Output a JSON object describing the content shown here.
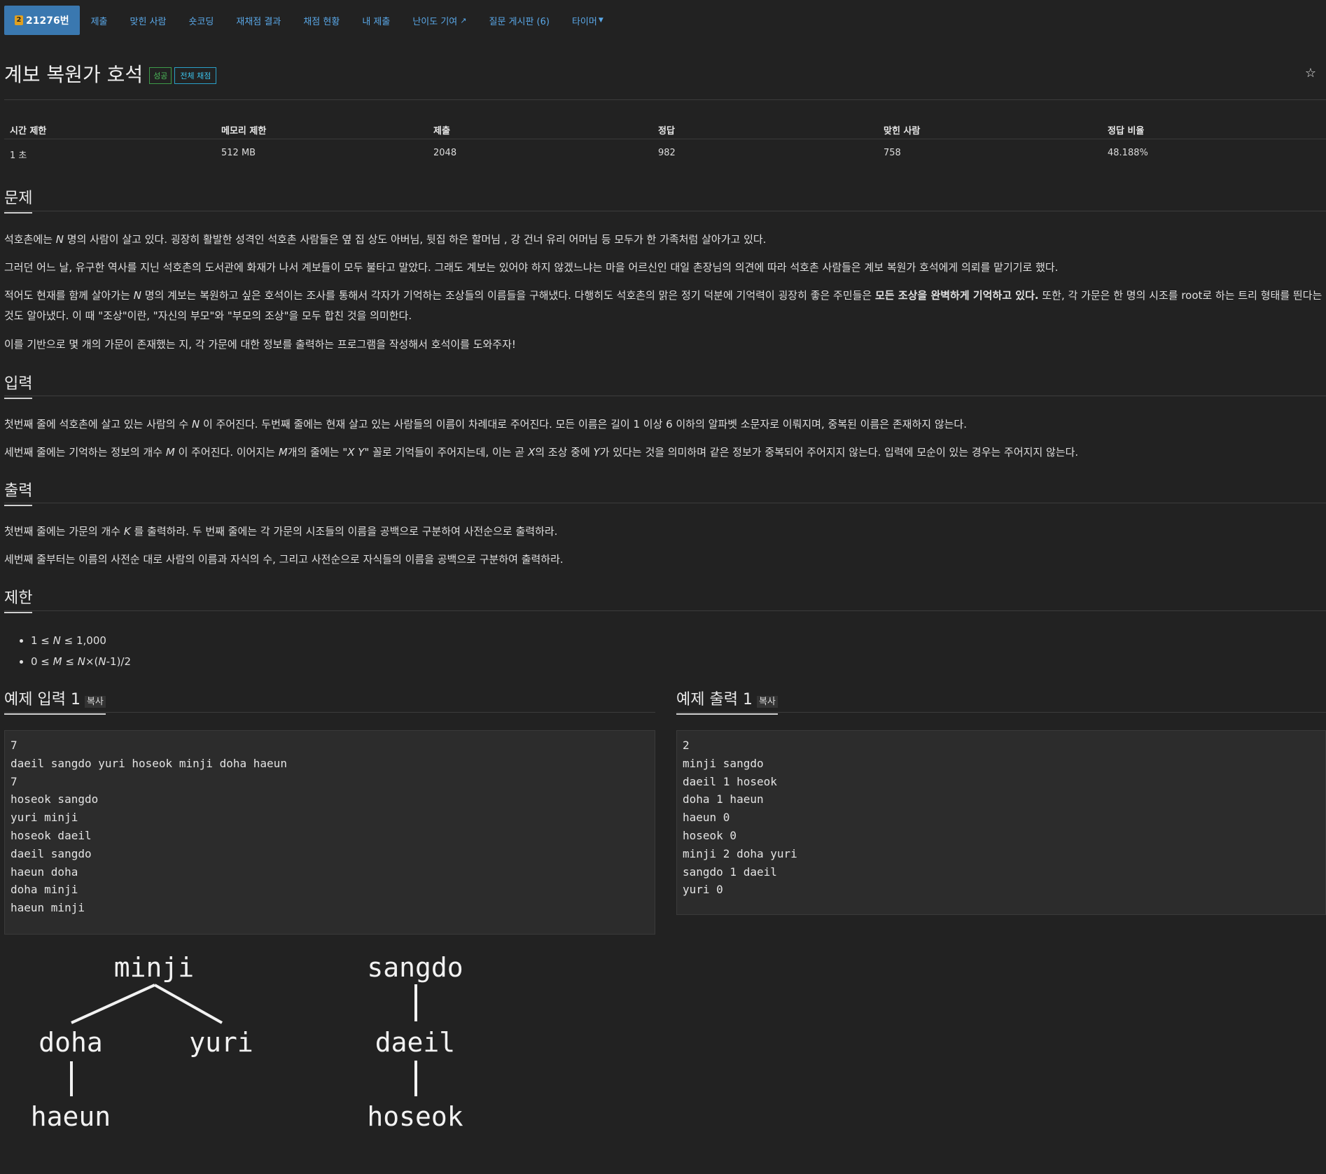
{
  "nav": {
    "problem_no": "21276번",
    "tier_glyph": "2",
    "items": [
      "제출",
      "맞힌 사람",
      "숏코딩",
      "재채점 결과",
      "채점 현황",
      "내 제출",
      "난이도 기여",
      "질문 게시판 (6)",
      "타이머"
    ]
  },
  "title": {
    "text": "계보 복원가 호석",
    "badge_success": "성공",
    "badge_all": "전체 채점",
    "star": "☆"
  },
  "stats": {
    "headers": [
      "시간 제한",
      "메모리 제한",
      "제출",
      "정답",
      "맞힌 사람",
      "정답 비율"
    ],
    "values": [
      "1 초",
      "512 MB",
      "2048",
      "982",
      "758",
      "48.188%"
    ]
  },
  "sections": {
    "problem": "문제",
    "input": "입력",
    "output": "출력",
    "limits": "제한",
    "sample_in": "예제 입력 1",
    "sample_out": "예제 출력 1",
    "copy": "복사"
  },
  "problem": {
    "p1_a": "석호촌에는 ",
    "p1_N": "N",
    "p1_b": " 명의 사람이 살고 있다. 굉장히 활발한 성격인 석호촌 사람들은 옆 집 상도 아버님, 뒷집 하은 할머님 , 강 건너 유리 어머님 등 모두가 한 가족처럼 살아가고 있다.",
    "p2": "그러던 어느 날, 유구한 역사를 지닌 석호촌의 도서관에 화재가 나서 계보들이 모두 불타고 말았다. 그래도 계보는 있어야 하지 않겠느냐는 마을 어르신인 대일 촌장님의 의견에 따라 석호촌 사람들은 계보 복원가 호석에게 의뢰를 맡기기로 했다.",
    "p3_a": "적어도 현재를 함께 살아가는 ",
    "p3_N": "N",
    "p3_b": " 명의 계보는 복원하고 싶은 호석이는 조사를 통해서 각자가 기억하는 조상들의 이름들을 구해냈다. 다행히도 석호촌의 맑은 정기 덕분에 기억력이 굉장히 좋은 주민들은 ",
    "p3_bold": "모든 조상을 완벽하게 기억하고 있다.",
    "p3_c": " 또한, 각 가문은 한 명의 시조를 root로 하는 트리 형태를 띈다는 것도 알아냈다. 이 때 \"조상\"이란, \"자신의 부모\"와 \"부모의 조상\"을 모두 합친 것을 의미한다.",
    "p4": "이를 기반으로 몇 개의 가문이 존재했는 지, 각 가문에 대한 정보를 출력하는 프로그램을 작성해서 호석이를 도와주자!"
  },
  "input": {
    "i1_a": "첫번째 줄에 석호촌에 살고 있는 사람의 수 ",
    "i1_N": "N",
    "i1_b": " 이 주어진다. 두번째 줄에는 현재 살고 있는 사람들의 이름이 차례대로 주어진다. 모든 이름은 길이 1 이상 6 이하의 알파벳 소문자로 이뤄지며, 중복된 이름은 존재하지 않는다.",
    "i2_a": "세번째 줄에는 기억하는 정보의 개수 ",
    "i2_M": "M",
    "i2_b": " 이 주어진다. 이어지는 ",
    "i2_M2": "M",
    "i2_c": "개의 줄에는 \"",
    "i2_XY": "X Y",
    "i2_d": "\" 꼴로 기억들이 주어지는데, 이는 곧 ",
    "i2_X": "X",
    "i2_e": "의 조상 중에 ",
    "i2_Y": "Y",
    "i2_f": "가 있다는 것을 의미하며 같은 정보가 중복되어 주어지지 않는다. 입력에 모순이 있는 경우는 주어지지 않는다."
  },
  "output": {
    "o1_a": "첫번째 줄에는 가문의 개수 ",
    "o1_K": "K",
    "o1_b": " 를 출력하라. 두 번째 줄에는 각 가문의 시조들의 이름을 공백으로 구분하여 사전순으로 출력하라.",
    "o2": "세번째 줄부터는 이름의 사전순 대로 사람의 이름과 자식의 수, 그리고 사전순으로 자식들의 이름을 공백으로 구분하여 출력하라."
  },
  "limits": {
    "l1_a": "1 ≤ ",
    "l1_N": "N",
    "l1_b": " ≤ 1,000",
    "l2_a": "0 ≤ ",
    "l2_M": "M",
    "l2_b": " ≤ ",
    "l2_N": "N",
    "l2_c": "×(",
    "l2_N2": "N",
    "l2_d": "-1)/2"
  },
  "sample_input": "7\ndaeil sangdo yuri hoseok minji doha haeun\n7\nhoseok sangdo\nyuri minji\nhoseok daeil\ndaeil sangdo\nhaeun doha\ndoha minji\nhaeun minji",
  "sample_output": "2\nminji sangdo\ndaeil 1 hoseok\ndoha 1 haeun\nhaeun 0\nhoseok 0\nminji 2 doha yuri\nsangdo 1 daeil\nyuri 0",
  "tree": {
    "left_root": "minji",
    "left_child_a": "doha",
    "left_child_b": "yuri",
    "left_grandchild": "haeun",
    "right_root": "sangdo",
    "right_child": "daeil",
    "right_grandchild": "hoseok"
  }
}
